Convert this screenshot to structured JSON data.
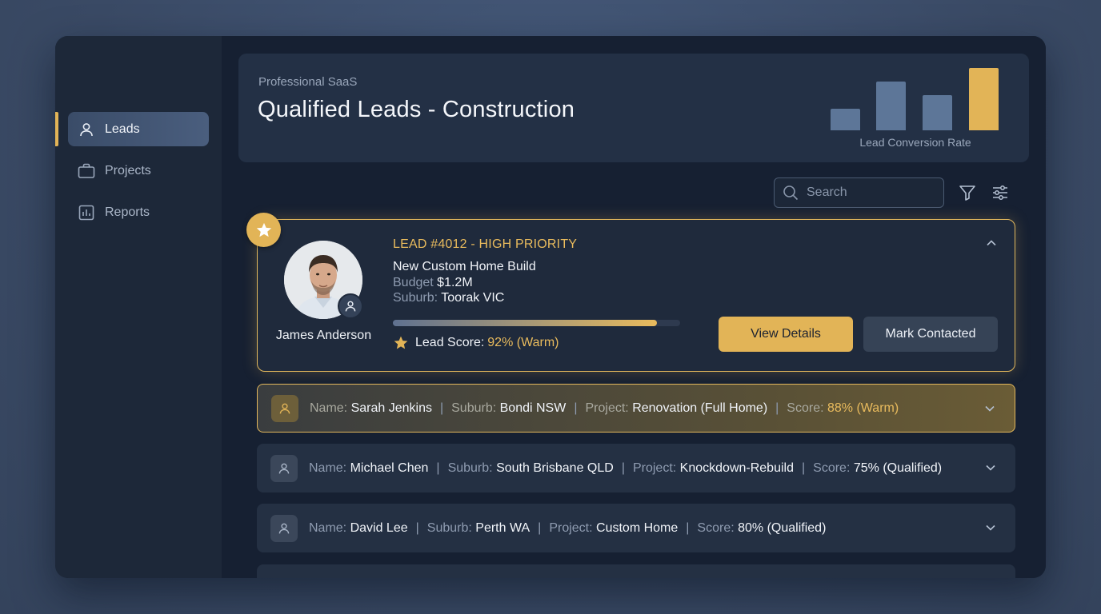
{
  "sidebar": {
    "items": [
      {
        "label": "Leads",
        "icon": "user-icon",
        "active": true
      },
      {
        "label": "Projects",
        "icon": "briefcase-icon",
        "active": false
      },
      {
        "label": "Reports",
        "icon": "bar-chart-icon",
        "active": false
      }
    ]
  },
  "header": {
    "eyebrow": "Professional SaaS",
    "title": "Qualified Leads - Construction",
    "chart_caption": "Lead Conversion Rate"
  },
  "chart_data": {
    "type": "bar",
    "categories": [
      "",
      "",
      "",
      ""
    ],
    "values": [
      35,
      78,
      56,
      100
    ],
    "colors": [
      "#5d7698",
      "#5d7698",
      "#5d7698",
      "#e2b457"
    ],
    "title": "Lead Conversion Rate",
    "ylim": [
      0,
      100
    ]
  },
  "toolbar": {
    "search_placeholder": "Search",
    "filter_icon": "filter-icon",
    "settings_icon": "sliders-icon"
  },
  "featured_lead": {
    "id_label": "LEAD #4012 - HIGH PRIORITY",
    "project": "New Custom Home Build",
    "budget_key": "Budget",
    "budget_value": "$1.2M",
    "suburb_key": "Suburb:",
    "suburb_value": "Toorak VIC",
    "name": "James Anderson",
    "score_key": "Lead Score:",
    "score_value": "92% (Warm)",
    "score_fraction": 0.92,
    "view_label": "View Details",
    "contact_label": "Mark Contacted",
    "accent": "#e2b457"
  },
  "leads": [
    {
      "name_key": "Name:",
      "name": "Sarah Jenkins",
      "suburb_key": "Suburb:",
      "suburb": "Bondi NSW",
      "project_key": "Project:",
      "project": "Renovation (Full Home)",
      "score_key": "Score:",
      "score": "88% (Warm)",
      "highlight": true
    },
    {
      "name_key": "Name:",
      "name": "Michael Chen",
      "suburb_key": "Suburb:",
      "suburb": "South Brisbane QLD",
      "project_key": "Project:",
      "project": "Knockdown-Rebuild",
      "score_key": "Score:",
      "score": "75% (Qualified)",
      "highlight": false
    },
    {
      "name_key": "Name:",
      "name": "David Lee",
      "suburb_key": "Suburb:",
      "suburb": "Perth WA",
      "project_key": "Project:",
      "project": "Custom Home",
      "score_key": "Score:",
      "score": "80% (Qualified)",
      "highlight": false
    }
  ]
}
